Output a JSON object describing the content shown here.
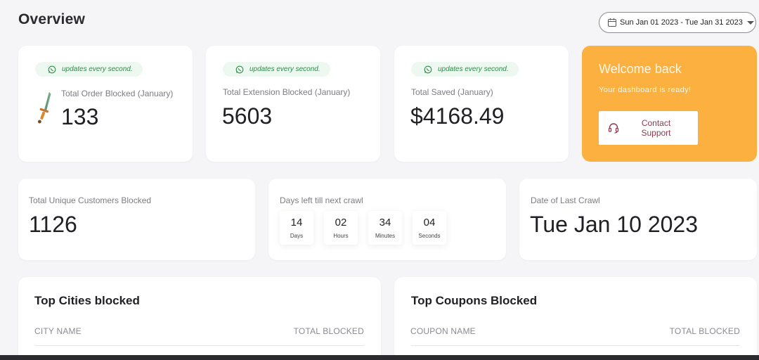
{
  "header": {
    "title": "Overview",
    "date_range": "Sun Jan 01 2023 - Tue Jan 31 2023"
  },
  "stats_top": [
    {
      "badge": "updates every second.",
      "label": "Total Order Blocked (January)",
      "value": "133",
      "icon": "sword-icon"
    },
    {
      "badge": "updates every second.",
      "label": "Total Extension Blocked (January)",
      "value": "5603"
    },
    {
      "badge": "updates every second.",
      "label": "Total Saved (January)",
      "value": "$4168.49"
    }
  ],
  "welcome": {
    "title": "Welcome back",
    "subtitle": "Your dashboard is ready!",
    "contact_line1": "Contact",
    "contact_line2": "Support",
    "bg_color": "#fbb040"
  },
  "stats_middle": {
    "unique_customers": {
      "label": "Total Unique Customers Blocked",
      "value": "1126"
    },
    "countdown": {
      "label": "Days left till next crawl",
      "units": [
        {
          "value": "14",
          "unit": "Days"
        },
        {
          "value": "02",
          "unit": "Hours"
        },
        {
          "value": "34",
          "unit": "Minutes"
        },
        {
          "value": "04",
          "unit": "Seconds"
        }
      ]
    },
    "last_crawl": {
      "label": "Date of Last Crawl",
      "value": "Tue Jan 10 2023"
    }
  },
  "cities_table": {
    "title": "Top Cities blocked",
    "col1": "CITY NAME",
    "col2": "TOTAL BLOCKED"
  },
  "coupons_table": {
    "title": "Top Coupons Blocked",
    "col1": "COUPON NAME",
    "col2": "TOTAL BLOCKED"
  },
  "colors": {
    "accent": "#fbb040",
    "badge_text": "#2f8a47",
    "badge_bg": "#edf8f0",
    "page_bg": "#f5f5f7"
  }
}
